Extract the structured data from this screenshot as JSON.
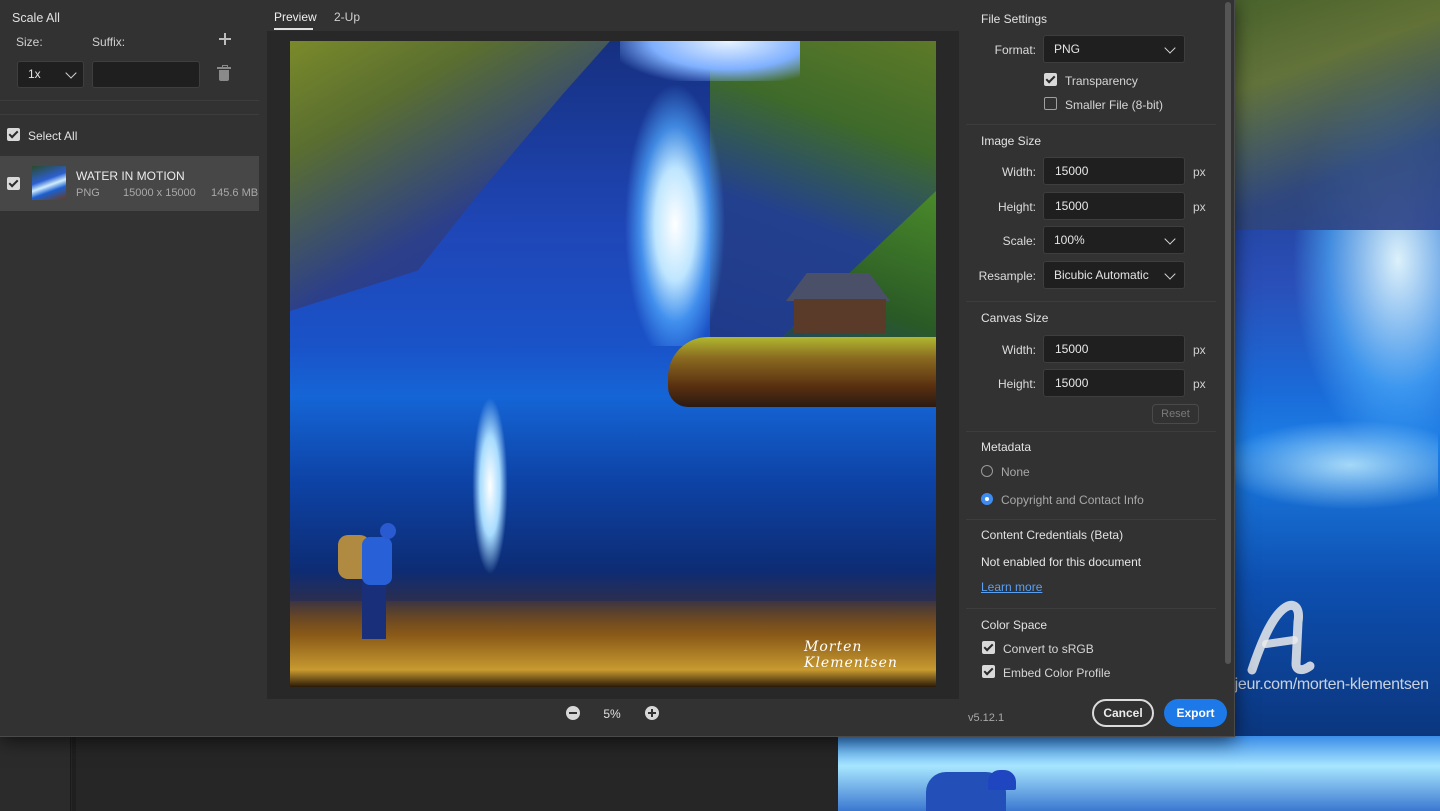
{
  "left_panel": {
    "title": "Scale All",
    "size_label": "Size:",
    "suffix_label": "Suffix:",
    "scale_value": "1x",
    "suffix_value": "",
    "select_all_label": "Select All",
    "select_all_checked": true,
    "assets": [
      {
        "name": "WATER IN MOTION",
        "format": "PNG",
        "dimensions": "15000 x 15000",
        "filesize": "145.6 MB",
        "checked": true
      }
    ]
  },
  "preview": {
    "tabs": [
      {
        "label": "Preview",
        "active": true
      },
      {
        "label": "2-Up",
        "active": false
      }
    ],
    "zoom": "5%",
    "signature": "Morten Klementsen"
  },
  "file_settings": {
    "title": "File Settings",
    "format_label": "Format:",
    "format_value": "PNG",
    "transparency_label": "Transparency",
    "transparency_checked": true,
    "smaller_file_label": "Smaller File (8-bit)",
    "smaller_file_checked": false
  },
  "image_size": {
    "title": "Image Size",
    "width_label": "Width:",
    "width_value": "15000",
    "height_label": "Height:",
    "height_value": "15000",
    "unit": "px",
    "scale_label": "Scale:",
    "scale_value": "100%",
    "resample_label": "Resample:",
    "resample_value": "Bicubic Automatic"
  },
  "canvas_size": {
    "title": "Canvas Size",
    "width_label": "Width:",
    "width_value": "15000",
    "height_label": "Height:",
    "height_value": "15000",
    "unit": "px",
    "reset_label": "Reset"
  },
  "metadata": {
    "title": "Metadata",
    "options": [
      {
        "label": "None",
        "selected": false
      },
      {
        "label": "Copyright and Contact Info",
        "selected": true
      }
    ]
  },
  "content_credentials": {
    "title": "Content Credentials (Beta)",
    "status": "Not enabled for this document",
    "link": "Learn more"
  },
  "color_space": {
    "title": "Color Space",
    "convert_label": "Convert to sRGB",
    "convert_checked": true,
    "embed_label": "Embed Color Profile",
    "embed_checked": true
  },
  "footer": {
    "version": "v5.12.1",
    "cancel_label": "Cancel",
    "export_label": "Export"
  },
  "watermark": {
    "text": "©Artmajeur.com/morten-klementsen"
  },
  "colors": {
    "accent": "#1d78e8",
    "link": "#5b9ff0",
    "dialog_bg": "#323232",
    "selected_row": "#474747"
  }
}
